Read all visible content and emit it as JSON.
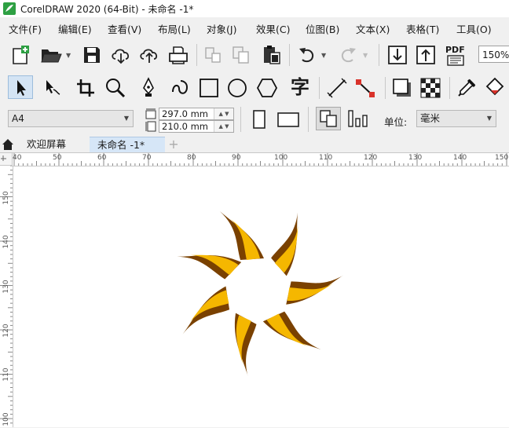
{
  "window": {
    "title": "CorelDRAW 2020 (64-Bit) - 未命名 -1*"
  },
  "menu": {
    "items": [
      {
        "label": "文件(F)"
      },
      {
        "label": "编辑(E)"
      },
      {
        "label": "查看(V)"
      },
      {
        "label": "布局(L)"
      },
      {
        "label": "对象(J)"
      },
      {
        "label": "效果(C)"
      },
      {
        "label": "位图(B)"
      },
      {
        "label": "文本(X)"
      },
      {
        "label": "表格(T)"
      },
      {
        "label": "工具(O)"
      }
    ]
  },
  "toolbar": {
    "pdf_label": "PDF",
    "zoom_value": "150%"
  },
  "toolbox": {
    "text_tool_glyph": "字"
  },
  "property_bar": {
    "page_size": "A4",
    "width_value": "297.0 mm",
    "height_value": "210.0 mm",
    "units_label": "单位:",
    "units_value": "毫米"
  },
  "tabs": [
    {
      "label": "欢迎屏幕"
    },
    {
      "label": "未命名 -1*"
    }
  ],
  "tab_add_label": "+",
  "rulers": {
    "horizontal": [
      "40",
      "50",
      "60",
      "70",
      "80",
      "90",
      "100",
      "110",
      "120",
      "130",
      "140",
      "150"
    ],
    "vertical": [
      "150",
      "140",
      "130",
      "120",
      "110",
      "100"
    ]
  },
  "colors": {
    "sun_outer": "#7a4100",
    "sun_inner": "#f5b700",
    "accent_red": "#d9322a",
    "accent_green": "#2ea043"
  }
}
